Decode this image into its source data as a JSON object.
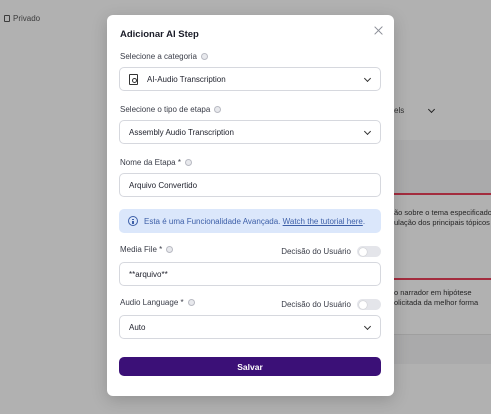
{
  "background": {
    "private_label": "Privado",
    "select_fragment": "els",
    "text_fragment_1a": "ão sobre o tema especificado",
    "text_fragment_1b": "ulação dos principais tópicos",
    "text_fragment_2a": "o narrador em hipótese",
    "text_fragment_2b": "olicitada da melhor forma"
  },
  "modal": {
    "title": "Adicionar AI Step",
    "category": {
      "label": "Selecione a categoria",
      "value": "AI-Audio Transcription",
      "icon": "audio-file-icon"
    },
    "step_type": {
      "label": "Selecione o tipo de etapa",
      "value": "Assembly Audio Transcription"
    },
    "step_name": {
      "label": "Nome da Etapa *",
      "value": "Arquivo Convertido"
    },
    "info": {
      "text": "Esta é uma Funcionalidade Avançada.",
      "link": "Watch the tutorial here",
      "suffix": "."
    },
    "media_file": {
      "label": "Media File *",
      "toggle_label": "Decisão do Usuário",
      "value": "**arquivo**"
    },
    "audio_language": {
      "label": "Audio Language *",
      "toggle_label": "Decisão do Usuário",
      "value": "Auto"
    },
    "save_label": "Salvar"
  },
  "colors": {
    "accent": "#3b1077",
    "info_bg": "#dbe7fb",
    "info_text": "#3d5fa8",
    "bg_red_line": "#e23d56"
  }
}
